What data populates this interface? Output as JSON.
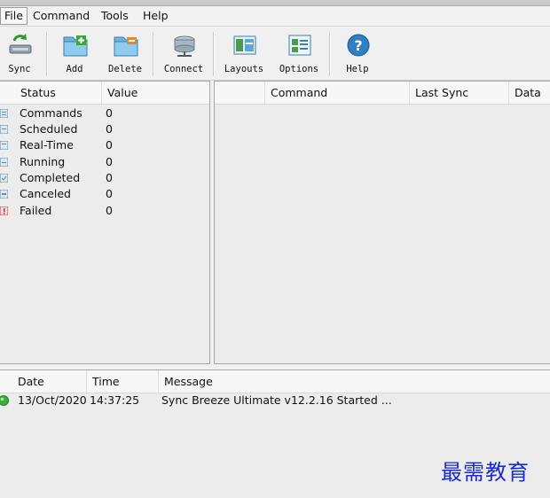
{
  "menu": {
    "file": "File",
    "command": "Command",
    "tools": "Tools",
    "help": "Help"
  },
  "toolbar": {
    "sync": "Sync",
    "add": "Add",
    "delete": "Delete",
    "connect": "Connect",
    "layouts": "Layouts",
    "options": "Options",
    "help": "Help"
  },
  "status_table": {
    "headers": {
      "status": "Status",
      "value": "Value"
    },
    "rows": [
      {
        "label": "Commands",
        "value": "0"
      },
      {
        "label": "Scheduled",
        "value": "0"
      },
      {
        "label": "Real-Time",
        "value": "0"
      },
      {
        "label": "Running",
        "value": "0"
      },
      {
        "label": "Completed",
        "value": "0"
      },
      {
        "label": "Canceled",
        "value": "0"
      },
      {
        "label": "Failed",
        "value": "0"
      }
    ]
  },
  "command_table": {
    "headers": {
      "command": "Command",
      "last_sync": "Last Sync",
      "data": "Data"
    }
  },
  "log": {
    "headers": {
      "date": "Date",
      "time": "Time",
      "message": "Message"
    },
    "rows": [
      {
        "date": "13/Oct/2020",
        "time": "14:37:25",
        "message": "Sync Breeze Ultimate v12.2.16 Started ..."
      }
    ]
  },
  "watermark": "最需教育",
  "colors": {
    "accent": "#1a2bd0",
    "status_ok": "#3fae3f"
  }
}
